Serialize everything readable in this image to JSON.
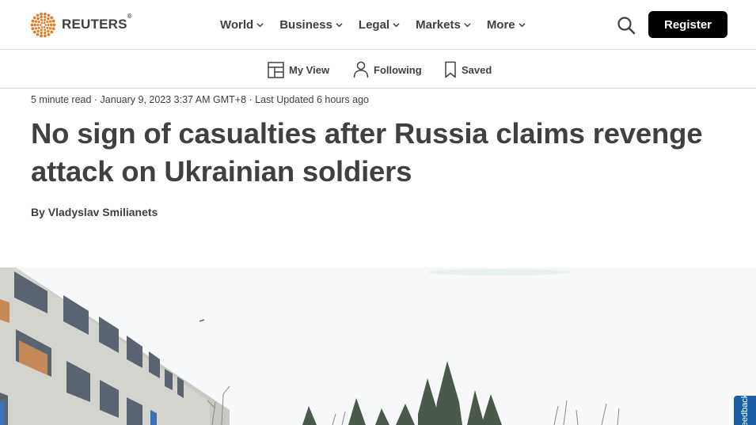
{
  "header": {
    "brand": "REUTERS",
    "brand_mark": "®",
    "nav": [
      {
        "label": "World"
      },
      {
        "label": "Business"
      },
      {
        "label": "Legal"
      },
      {
        "label": "Markets"
      },
      {
        "label": "More"
      }
    ],
    "register_label": "Register"
  },
  "subnav": {
    "my_view": "My View",
    "following": "Following",
    "saved": "Saved"
  },
  "article": {
    "meta": "5 minute read · January 9, 2023 3:37 AM GMT+8 · Last Updated 6 hours ago",
    "headline": "No sign of casualties after Russia claims revenge attack on Ukrainian soldiers",
    "byline_prefix": "By ",
    "author": "Vladyslav Smilianets"
  },
  "feedback_label": "Feedback",
  "colors": {
    "text": "#404040",
    "register_bg": "#000000",
    "brand_orange": "#e37d26",
    "feedback_bg": "#1b5fa8"
  }
}
